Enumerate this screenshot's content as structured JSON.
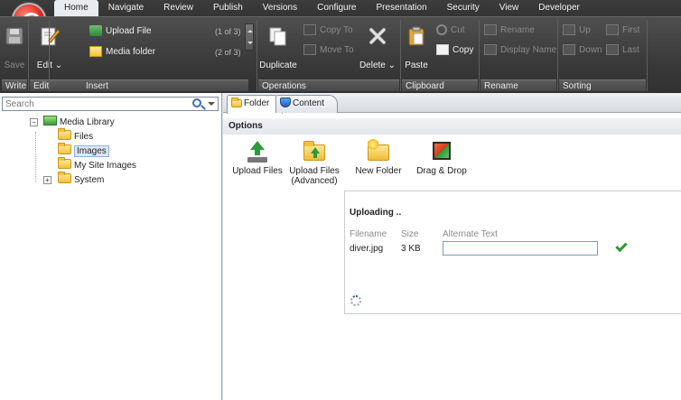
{
  "ribbon": {
    "tabs": [
      "Home",
      "Navigate",
      "Review",
      "Publish",
      "Versions",
      "Configure",
      "Presentation",
      "Security",
      "View",
      "Developer"
    ],
    "active_tab": "Home",
    "write": {
      "save_label": "Save",
      "group_label": "Write"
    },
    "edit": {
      "edit_label": "Edit",
      "group_label": "Edit"
    },
    "insert": {
      "upload_file_label": "Upload File",
      "upload_file_count": "(1 of 3)",
      "media_folder_label": "Media folder",
      "media_folder_count": "(2 of 3)",
      "group_label": "Insert"
    },
    "operations": {
      "duplicate_label": "Duplicate",
      "copy_to_label": "Copy To",
      "move_to_label": "Move To",
      "delete_label": "Delete",
      "group_label": "Operations"
    },
    "clipboard": {
      "paste_label": "Paste",
      "cut_label": "Cut",
      "copy_label": "Copy",
      "group_label": "Clipboard"
    },
    "rename": {
      "rename_label": "Rename",
      "display_name_label": "Display Name",
      "group_label": "Rename"
    },
    "sorting": {
      "up_label": "Up",
      "first_label": "First",
      "down_label": "Down",
      "last_label": "Last",
      "group_label": "Sorting"
    }
  },
  "sidebar": {
    "search_placeholder": "Search",
    "tree": [
      {
        "label": "Media Library",
        "expander": "−",
        "icon": "media-library-icon"
      },
      {
        "label": "Files",
        "icon": "folder-icon"
      },
      {
        "label": "Images",
        "icon": "folder-icon",
        "selected": true
      },
      {
        "label": "My Site Images",
        "icon": "folder-icon"
      },
      {
        "label": "System",
        "expander": "+",
        "icon": "folder-icon"
      }
    ]
  },
  "main": {
    "tabs": [
      {
        "label": "Folder",
        "icon": "folder-icon",
        "active": true
      },
      {
        "label": "Content",
        "icon": "shield-icon"
      }
    ],
    "options_title": "Options",
    "actions": [
      {
        "label": "Upload Files",
        "icon": "upload-icon"
      },
      {
        "label": "Upload Files (Advanced)",
        "icon": "upload-advanced-icon"
      },
      {
        "label": "New Folder",
        "icon": "new-folder-icon"
      },
      {
        "label": "Drag & Drop",
        "icon": "drag-drop-icon"
      }
    ],
    "upload": {
      "title": "Uploading ..",
      "columns": [
        "Filename",
        "Size",
        "Alternate Text"
      ],
      "rows": [
        {
          "filename": "diver.jpg",
          "size": "3 KB",
          "alt_text": ""
        }
      ]
    }
  },
  "colors": {
    "accent": "#2f9a33",
    "ribbon_dark": "#2a2a2a",
    "selection": "#dde8f7"
  }
}
